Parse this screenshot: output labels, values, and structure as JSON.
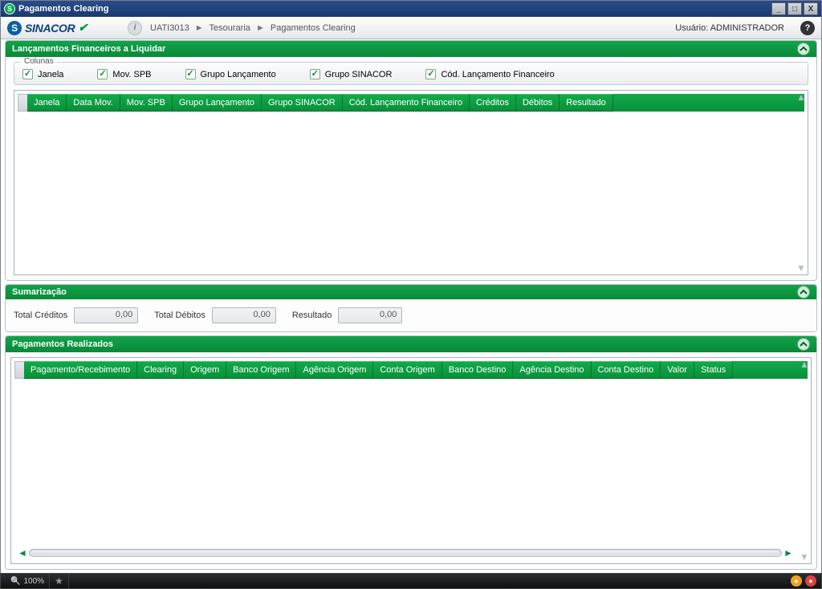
{
  "window": {
    "title": "Pagamentos Clearing"
  },
  "header": {
    "logo": "SINACOR",
    "breadcrumb": [
      "UATI3013",
      "Tesouraria",
      "Pagamentos Clearing"
    ],
    "user_label": "Usuário:",
    "user_name": "ADMINISTRADOR"
  },
  "panel1": {
    "title": "Lançamentos Financeiros a Liquidar",
    "fieldset_legend": "Colunas",
    "checkboxes": [
      {
        "label": "Janela",
        "checked": true
      },
      {
        "label": "Mov. SPB",
        "checked": true
      },
      {
        "label": "Grupo Lançamento",
        "checked": true
      },
      {
        "label": "Grupo SINACOR",
        "checked": true
      },
      {
        "label": "Cód. Lançamento Financeiro",
        "checked": true
      }
    ],
    "columns": [
      "Janela",
      "Data Mov.",
      "Mov. SPB",
      "Grupo Lançamento",
      "Grupo SINACOR",
      "Cód. Lançamento Financeiro",
      "Créditos",
      "Débitos",
      "Resultado"
    ]
  },
  "panel2": {
    "title": "Sumarização",
    "fields": {
      "total_creditos": {
        "label": "Total Créditos",
        "value": "0,00"
      },
      "total_debitos": {
        "label": "Total Débitos",
        "value": "0,00"
      },
      "resultado": {
        "label": "Resultado",
        "value": "0,00"
      }
    }
  },
  "panel3": {
    "title": "Pagamentos Realizados",
    "columns": [
      "Pagamento/Recebimento",
      "Clearing",
      "Origem",
      "Banco Origem",
      "Agência Origem",
      "Conta Origem",
      "Banco Destino",
      "Agência Destino",
      "Conta Destino",
      "Valor",
      "Status"
    ]
  },
  "statusbar": {
    "zoom": "100%"
  }
}
